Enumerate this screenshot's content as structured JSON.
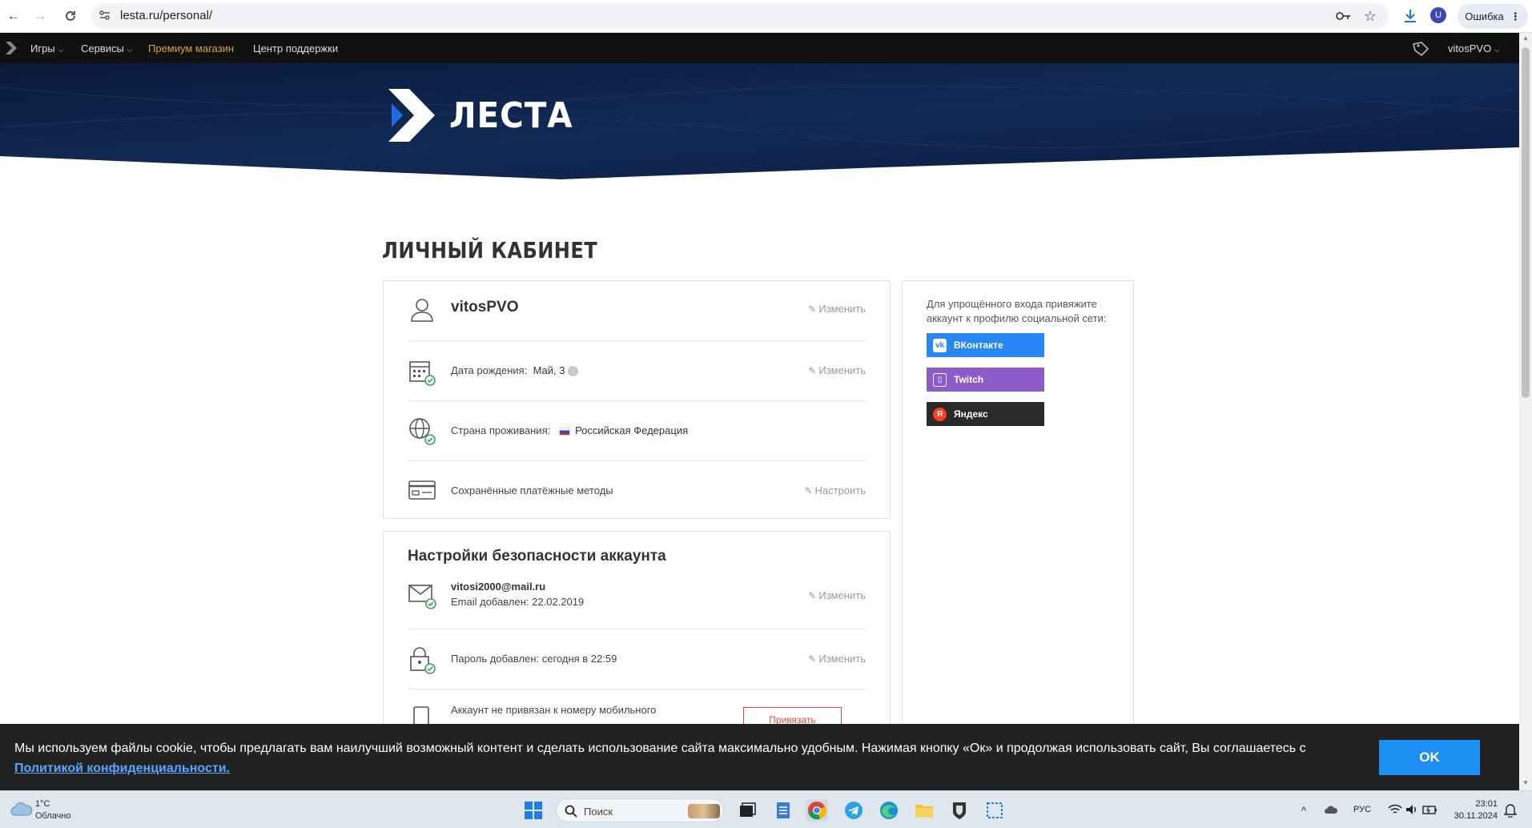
{
  "browser": {
    "url": "lesta.ru/personal/",
    "error_label": "Ошибка",
    "profile_letter": "U"
  },
  "topnav": {
    "games": "Игры",
    "services": "Сервисы",
    "premium": "Премиум магазин",
    "support": "Центр поддержки",
    "username": "vitosPVO"
  },
  "hero": {
    "logo_text": "ЛЕСТА"
  },
  "page": {
    "title": "ЛИЧНЫЙ КАБИНЕТ"
  },
  "profile": {
    "username": "vitosPVO",
    "edit_label": "Изменить",
    "birth_label": "Дата рождения:",
    "birth_value": "Май, 3",
    "country_label": "Страна проживания:",
    "country_value": "Российская Федерация",
    "payment_label": "Сохранённые платёжные методы",
    "configure_label": "Настроить"
  },
  "security": {
    "title": "Настройки безопасности аккаунта",
    "email": "vitosi2000@mail.ru",
    "email_added": "Email добавлен: 22.02.2019",
    "password_added": "Пароль добавлен: сегодня в 22:59",
    "phone_text": "Аккаунт не привязан к номеру мобильного",
    "bind_label": "Привязать",
    "edit_label": "Изменить"
  },
  "social": {
    "text": "Для упрощённого входа привяжите аккаунт к профилю социальной сети:",
    "vk": "ВКонтакте",
    "twitch": "Twitch",
    "yandex": "Яндекс",
    "colors": {
      "vk": "#2787f5",
      "twitch": "#8c5bc8",
      "yandex": "#2a2a2a"
    }
  },
  "cookie": {
    "text": "Мы используем файлы cookie, чтобы предлагать вам наилучший возможный контент и сделать использование сайта максимально удобным. Нажимая кнопку «Ок» и продолжая использовать сайт, Вы соглашаетесь с",
    "link": "Политикой конфиденциальности.",
    "ok": "OK"
  },
  "taskbar": {
    "temperature": "1°C",
    "condition": "Облачно",
    "search": "Поиск",
    "lang": "РУС",
    "time": "23:01",
    "date": "30.11.2024"
  }
}
